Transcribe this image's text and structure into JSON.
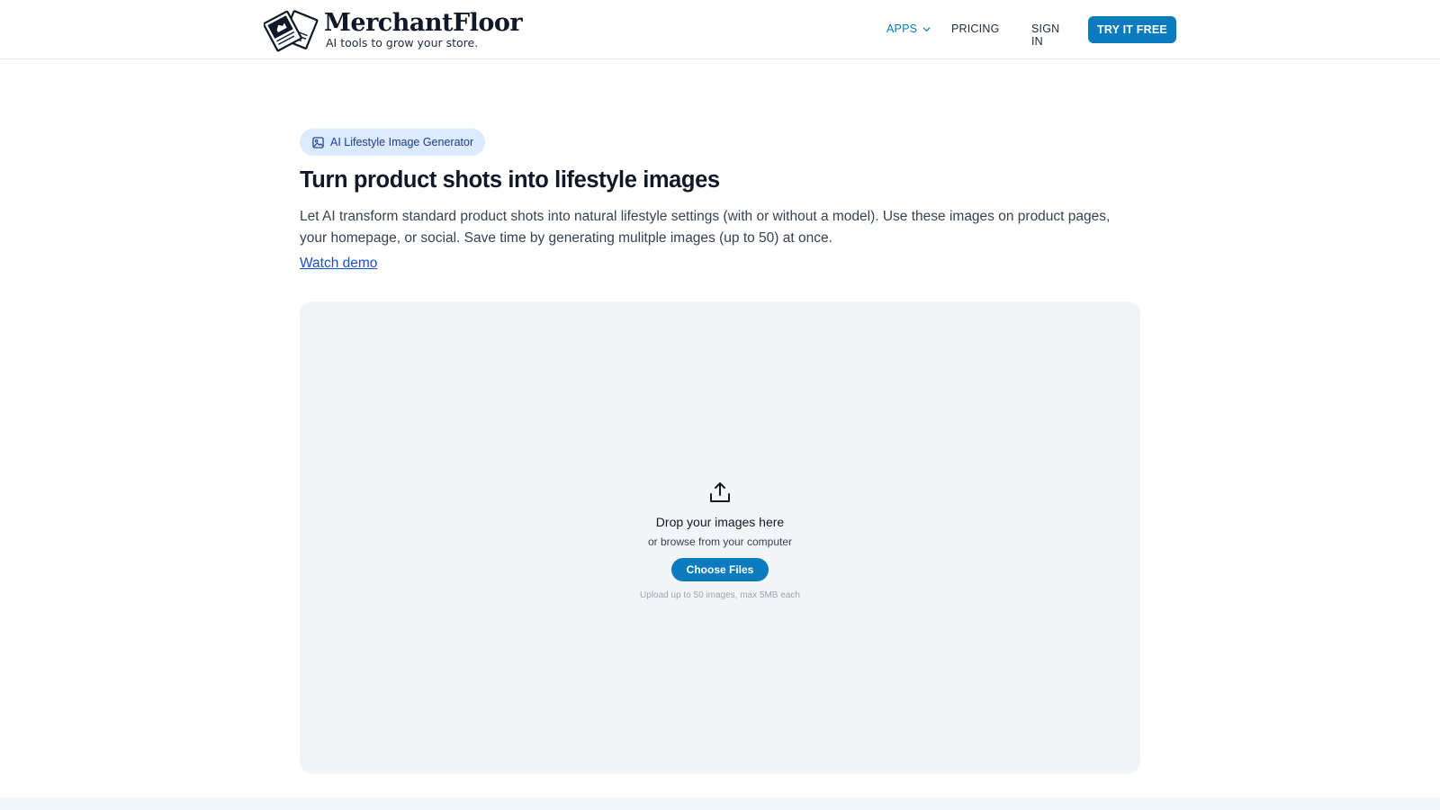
{
  "header": {
    "brand_name": "MerchantFloor",
    "tagline": "AI tools to grow your store.",
    "nav": {
      "apps_label": "APPS",
      "pricing_label": "PRICING",
      "signin_label": "SIGN IN",
      "cta_label": "TRY IT FREE"
    }
  },
  "main": {
    "badge_label": "AI Lifestyle Image Generator",
    "title": "Turn product shots into lifestyle images",
    "description": "Let AI transform standard product shots into natural lifestyle settings (with or without a model). Use these images on product pages, your homepage, or social. Save time by generating mulitple images (up to 50) at once.",
    "demo_link": "Watch demo"
  },
  "upload": {
    "title": "Drop your images here",
    "subtitle": "or browse from your computer",
    "button_label": "Choose Files",
    "hint": "Upload up to 50 images, max 5MB each"
  },
  "colors": {
    "accent": "#0b7bbf",
    "badge_bg": "#dbeafe",
    "dropzone_bg": "#f3f4f6",
    "link": "#1d4ed8"
  },
  "icons": {
    "logo": "photo-stack-logo-icon",
    "apps_dropdown": "chevron-down-icon",
    "badge": "image-icon",
    "upload": "upload-icon"
  }
}
